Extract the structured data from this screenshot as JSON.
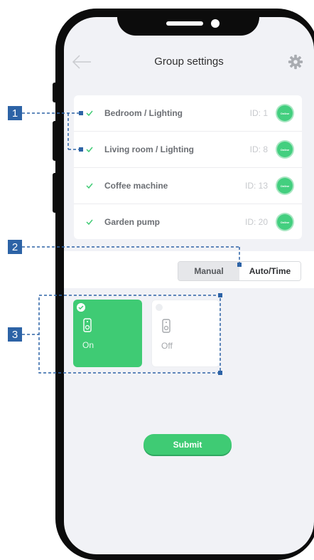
{
  "header": {
    "title": "Group settings",
    "back_icon": "arrow-left-icon",
    "settings_icon": "gear-icon"
  },
  "devices": [
    {
      "name": "Bedroom / Lighting",
      "id": "ID: 1",
      "status": "Online"
    },
    {
      "name": "Living room / Lighting",
      "id": "ID: 8",
      "status": "Online"
    },
    {
      "name": "Coffee machine",
      "id": "ID: 13",
      "status": "Online"
    },
    {
      "name": "Garden pump",
      "id": "ID: 20",
      "status": "Online"
    }
  ],
  "mode": {
    "manual_label": "Manual",
    "auto_label": "Auto/Time",
    "selected": "Auto/Time"
  },
  "state_tiles": [
    {
      "label": "On",
      "selected": true,
      "icon": "plug-icon"
    },
    {
      "label": "Off",
      "selected": false,
      "icon": "plug-icon"
    }
  ],
  "submit_label": "Submit",
  "callouts": [
    "1",
    "2",
    "3"
  ],
  "colors": {
    "accent_green": "#3fcb74",
    "callout_blue": "#2d63a6"
  }
}
